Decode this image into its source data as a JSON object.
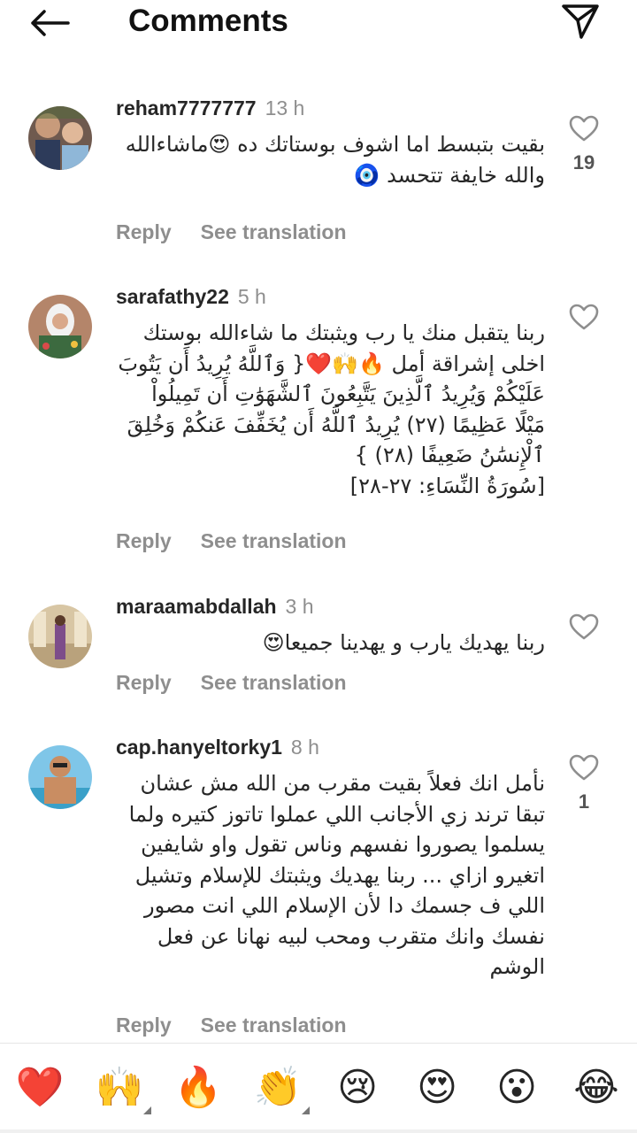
{
  "header": {
    "title": "Comments"
  },
  "action_labels": {
    "reply": "Reply",
    "translate": "See translation"
  },
  "comments": [
    {
      "username": "reham7777777",
      "time": "13 h",
      "text_lines": [
        "بقيت بتبسط اما اشوف بوستاتك ده 😍ماشاءالله",
        "والله خايفة تتحسد 🧿"
      ],
      "likes": "19"
    },
    {
      "username": "sarafathy22",
      "time": "5 h",
      "text_lines": [
        "ربنا يتقبل منك يا رب ويثبتك ما شاءالله بوستك",
        "اخلى إشراقة أمل 🔥🙌❤️{ وَٱللَّهُ يُرِيدُ أَن يَتُوبَ",
        "عَلَيْكُمْ وَيُرِيدُ ٱلَّذِينَ يَتَّبِعُونَ ٱلشَّهَوَٰتِ أَن تَمِيلُواْ",
        "مَيْلًا عَظِيمًا (٢٧) يُرِيدُ ٱللَّهُ أَن يُخَفِّفَ عَنكُمْ وَخُلِقَ",
        "ٱلْإِنسَٰنُ ضَعِيفًا (٢٨) }",
        "[سُورَةُ النِّسَاءِ: ٢٧-٢٨]"
      ],
      "likes": ""
    },
    {
      "username": "maraamabdallah",
      "time": "3 h",
      "text_lines": [
        "ربنا يهديك يارب و يهدينا جميعا😍"
      ],
      "likes": ""
    },
    {
      "username": "cap.hanyeltorky1",
      "time": "8 h",
      "text_lines": [
        "نأمل انك فعلاً بقيت مقرب من الله مش عشان",
        "تبقا ترند زي الأجانب اللي عملوا تاتوز كتيره ولما",
        "يسلموا يصوروا نفسهم وناس تقول واو شايفين",
        "اتغيرو ازاي ... ربنا يهديك ويثبتك للإسلام وتشيل",
        "اللي ف جسمك دا لأن الإسلام اللي انت مصور",
        "نفسك وانك متقرب ومحب لبيه نهانا عن فعل",
        "الوشم"
      ],
      "likes": "1"
    }
  ],
  "reactions": [
    "❤️",
    "🙌",
    "🔥",
    "👏",
    "😢",
    "😍",
    "😮",
    "😂"
  ],
  "icons": {
    "back": "arrow-left-icon",
    "share": "paper-plane-icon",
    "like": "heart-outline-icon"
  }
}
